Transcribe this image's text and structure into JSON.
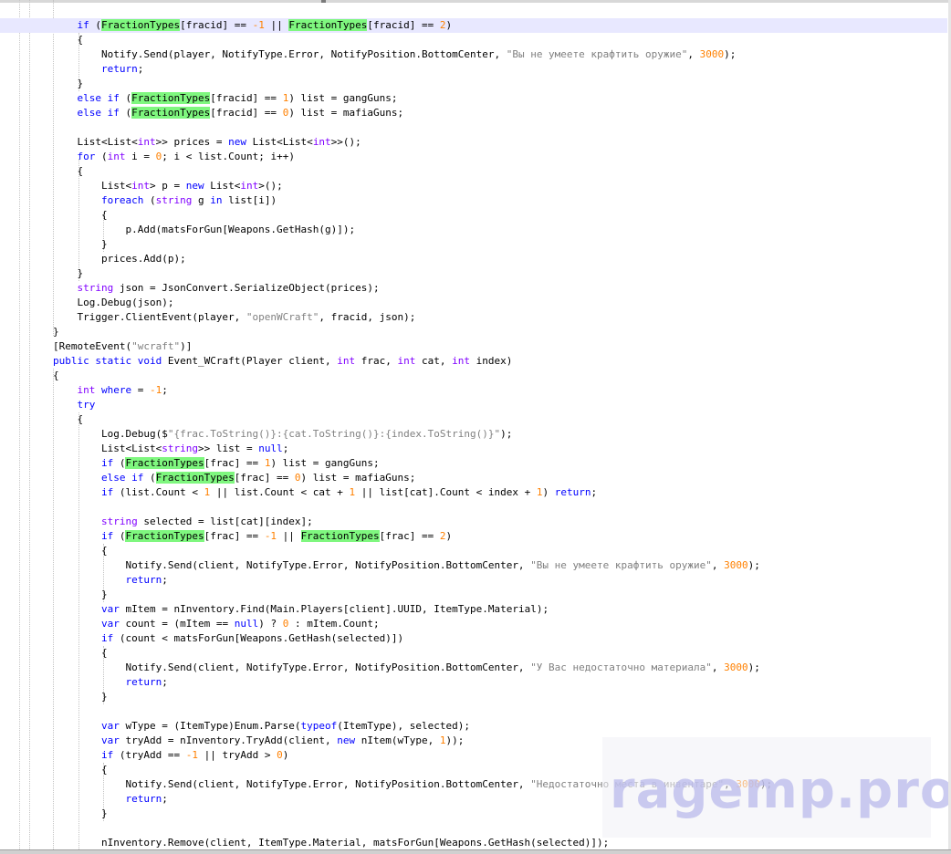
{
  "editor": {
    "theme": {
      "keyword": "#0000ff",
      "type": "#8000ff",
      "number": "#ff8000",
      "string": "#808080",
      "highlight": "#7ff77f",
      "current_line": "#e8e8ff"
    },
    "lines": [
      [
        [
          "    ",
          ""
        ],
        [
          "if",
          "kw"
        ],
        [
          " (",
          ""
        ],
        [
          "FractionTypes",
          "hl"
        ],
        [
          "[fracid] == ",
          ""
        ],
        [
          "-1",
          "nm"
        ],
        [
          " || ",
          ""
        ],
        [
          "FractionTypes",
          "hl"
        ],
        [
          "[fracid] == ",
          ""
        ],
        [
          "2",
          "nm"
        ],
        [
          ")",
          ""
        ]
      ],
      [
        [
          "    {",
          ""
        ]
      ],
      [
        [
          "        Notify.Send(player, NotifyType.Error, NotifyPosition.BottomCenter, ",
          ""
        ],
        [
          "\"Вы не умеете крафтить оружие\"",
          "st"
        ],
        [
          ", ",
          ""
        ],
        [
          "3000",
          "nm"
        ],
        [
          ");",
          ""
        ]
      ],
      [
        [
          "        ",
          ""
        ],
        [
          "return",
          "kw"
        ],
        [
          ";",
          ""
        ]
      ],
      [
        [
          "    }",
          ""
        ]
      ],
      [
        [
          "    ",
          ""
        ],
        [
          "else if",
          "kw"
        ],
        [
          " (",
          ""
        ],
        [
          "FractionTypes",
          "hl"
        ],
        [
          "[fracid] == ",
          ""
        ],
        [
          "1",
          "nm"
        ],
        [
          ") list = gangGuns;",
          ""
        ]
      ],
      [
        [
          "    ",
          ""
        ],
        [
          "else if",
          "kw"
        ],
        [
          " (",
          ""
        ],
        [
          "FractionTypes",
          "hl"
        ],
        [
          "[fracid] == ",
          ""
        ],
        [
          "0",
          "nm"
        ],
        [
          ") list = mafiaGuns;",
          ""
        ]
      ],
      [
        [
          "",
          ""
        ]
      ],
      [
        [
          "    List<List<",
          ""
        ],
        [
          "int",
          "ty"
        ],
        [
          ">> prices = ",
          ""
        ],
        [
          "new",
          "kw"
        ],
        [
          " List<List<",
          ""
        ],
        [
          "int",
          "ty"
        ],
        [
          ">>();",
          ""
        ]
      ],
      [
        [
          "    ",
          ""
        ],
        [
          "for",
          "kw"
        ],
        [
          " (",
          ""
        ],
        [
          "int",
          "ty"
        ],
        [
          " i = ",
          ""
        ],
        [
          "0",
          "nm"
        ],
        [
          "; i < list.Count; i++)",
          ""
        ]
      ],
      [
        [
          "    {",
          ""
        ]
      ],
      [
        [
          "        List<",
          ""
        ],
        [
          "int",
          "ty"
        ],
        [
          "> p = ",
          ""
        ],
        [
          "new",
          "kw"
        ],
        [
          " List<",
          ""
        ],
        [
          "int",
          "ty"
        ],
        [
          ">();",
          ""
        ]
      ],
      [
        [
          "        ",
          ""
        ],
        [
          "foreach",
          "kw"
        ],
        [
          " (",
          ""
        ],
        [
          "string",
          "ty"
        ],
        [
          " g ",
          ""
        ],
        [
          "in",
          "kw"
        ],
        [
          " list[i])",
          ""
        ]
      ],
      [
        [
          "        {",
          ""
        ]
      ],
      [
        [
          "            p.Add(matsForGun[Weapons.GetHash(g)]);",
          ""
        ]
      ],
      [
        [
          "        }",
          ""
        ]
      ],
      [
        [
          "        prices.Add(p);",
          ""
        ]
      ],
      [
        [
          "    }",
          ""
        ]
      ],
      [
        [
          "    ",
          ""
        ],
        [
          "string",
          "ty"
        ],
        [
          " json = JsonConvert.SerializeObject(prices);",
          ""
        ]
      ],
      [
        [
          "    Log.Debug(json);",
          ""
        ]
      ],
      [
        [
          "    Trigger.ClientEvent(player, ",
          ""
        ],
        [
          "\"openWCraft\"",
          "st"
        ],
        [
          ", fracid, json);",
          ""
        ]
      ],
      [
        [
          "}",
          ""
        ]
      ],
      [
        [
          "[RemoteEvent(",
          ""
        ],
        [
          "\"wcraft\"",
          "st"
        ],
        [
          ")]",
          ""
        ]
      ],
      [
        [
          "",
          ""
        ],
        [
          "public static void",
          "kw"
        ],
        [
          " Event_WCraft(Player client, ",
          ""
        ],
        [
          "int",
          "ty"
        ],
        [
          " frac, ",
          ""
        ],
        [
          "int",
          "ty"
        ],
        [
          " cat, ",
          ""
        ],
        [
          "int",
          "ty"
        ],
        [
          " index)",
          ""
        ]
      ],
      [
        [
          "{",
          ""
        ]
      ],
      [
        [
          "    ",
          ""
        ],
        [
          "int",
          "ty"
        ],
        [
          " ",
          ""
        ],
        [
          "where",
          "kw"
        ],
        [
          " = ",
          ""
        ],
        [
          "-1",
          "nm"
        ],
        [
          ";",
          ""
        ]
      ],
      [
        [
          "    ",
          ""
        ],
        [
          "try",
          "kw"
        ]
      ],
      [
        [
          "    {",
          ""
        ]
      ],
      [
        [
          "        Log.Debug($",
          ""
        ],
        [
          "\"{frac.ToString()}:{cat.ToString()}:{index.ToString()}\"",
          "st"
        ],
        [
          ");",
          ""
        ]
      ],
      [
        [
          "        List<List<",
          ""
        ],
        [
          "string",
          "ty"
        ],
        [
          ">> list = ",
          ""
        ],
        [
          "null",
          "kw"
        ],
        [
          ";",
          ""
        ]
      ],
      [
        [
          "        ",
          ""
        ],
        [
          "if",
          "kw"
        ],
        [
          " (",
          ""
        ],
        [
          "FractionTypes",
          "hl"
        ],
        [
          "[frac] == ",
          ""
        ],
        [
          "1",
          "nm"
        ],
        [
          ") list = gangGuns;",
          ""
        ]
      ],
      [
        [
          "        ",
          ""
        ],
        [
          "else if",
          "kw"
        ],
        [
          " (",
          ""
        ],
        [
          "FractionTypes",
          "hl"
        ],
        [
          "[frac] == ",
          ""
        ],
        [
          "0",
          "nm"
        ],
        [
          ") list = mafiaGuns;",
          ""
        ]
      ],
      [
        [
          "        ",
          ""
        ],
        [
          "if",
          "kw"
        ],
        [
          " (list.Count < ",
          ""
        ],
        [
          "1",
          "nm"
        ],
        [
          " || list.Count < cat + ",
          ""
        ],
        [
          "1",
          "nm"
        ],
        [
          " || list[cat].Count < index + ",
          ""
        ],
        [
          "1",
          "nm"
        ],
        [
          ") ",
          ""
        ],
        [
          "return",
          "kw"
        ],
        [
          ";",
          ""
        ]
      ],
      [
        [
          "",
          ""
        ]
      ],
      [
        [
          "        ",
          ""
        ],
        [
          "string",
          "ty"
        ],
        [
          " selected = list[cat][index];",
          ""
        ]
      ],
      [
        [
          "        ",
          ""
        ],
        [
          "if",
          "kw"
        ],
        [
          " (",
          ""
        ],
        [
          "FractionTypes",
          "hl"
        ],
        [
          "[frac] == ",
          ""
        ],
        [
          "-1",
          "nm"
        ],
        [
          " || ",
          ""
        ],
        [
          "FractionTypes",
          "hl"
        ],
        [
          "[frac] == ",
          ""
        ],
        [
          "2",
          "nm"
        ],
        [
          ")",
          ""
        ]
      ],
      [
        [
          "        {",
          ""
        ]
      ],
      [
        [
          "            Notify.Send(client, NotifyType.Error, NotifyPosition.BottomCenter, ",
          ""
        ],
        [
          "\"Вы не умеете крафтить оружие\"",
          "st"
        ],
        [
          ", ",
          ""
        ],
        [
          "3000",
          "nm"
        ],
        [
          ");",
          ""
        ]
      ],
      [
        [
          "            ",
          ""
        ],
        [
          "return",
          "kw"
        ],
        [
          ";",
          ""
        ]
      ],
      [
        [
          "        }",
          ""
        ]
      ],
      [
        [
          "        ",
          ""
        ],
        [
          "var",
          "kw"
        ],
        [
          " mItem = nInventory.Find(Main.Players[client].UUID, ItemType.Material);",
          ""
        ]
      ],
      [
        [
          "        ",
          ""
        ],
        [
          "var",
          "kw"
        ],
        [
          " count = (mItem == ",
          ""
        ],
        [
          "null",
          "kw"
        ],
        [
          ") ? ",
          ""
        ],
        [
          "0",
          "nm"
        ],
        [
          " : mItem.Count;",
          ""
        ]
      ],
      [
        [
          "        ",
          ""
        ],
        [
          "if",
          "kw"
        ],
        [
          " (count < matsForGun[Weapons.GetHash(selected)])",
          ""
        ]
      ],
      [
        [
          "        {",
          ""
        ]
      ],
      [
        [
          "            Notify.Send(client, NotifyType.Error, NotifyPosition.BottomCenter, ",
          ""
        ],
        [
          "\"У Вас недостаточно материала\"",
          "st"
        ],
        [
          ", ",
          ""
        ],
        [
          "3000",
          "nm"
        ],
        [
          ");",
          ""
        ]
      ],
      [
        [
          "            ",
          ""
        ],
        [
          "return",
          "kw"
        ],
        [
          ";",
          ""
        ]
      ],
      [
        [
          "        }",
          ""
        ]
      ],
      [
        [
          "",
          ""
        ]
      ],
      [
        [
          "        ",
          ""
        ],
        [
          "var",
          "kw"
        ],
        [
          " wType = (ItemType)Enum.Parse(",
          ""
        ],
        [
          "typeof",
          "kw"
        ],
        [
          "(ItemType), selected);",
          ""
        ]
      ],
      [
        [
          "        ",
          ""
        ],
        [
          "var",
          "kw"
        ],
        [
          " tryAdd = nInventory.TryAdd(client, ",
          ""
        ],
        [
          "new",
          "kw"
        ],
        [
          " nItem(wType, ",
          ""
        ],
        [
          "1",
          "nm"
        ],
        [
          "));",
          ""
        ]
      ],
      [
        [
          "        ",
          ""
        ],
        [
          "if",
          "kw"
        ],
        [
          " (tryAdd == ",
          ""
        ],
        [
          "-1",
          "nm"
        ],
        [
          " || tryAdd > ",
          ""
        ],
        [
          "0",
          "nm"
        ],
        [
          ")",
          ""
        ]
      ],
      [
        [
          "        {",
          ""
        ]
      ],
      [
        [
          "            Notify.Send(client, NotifyType.Error, NotifyPosition.BottomCenter, ",
          ""
        ],
        [
          "\"Недостаточно места в инвентаре\"",
          "st"
        ],
        [
          ", ",
          ""
        ],
        [
          "3000",
          "nm"
        ],
        [
          ");",
          ""
        ]
      ],
      [
        [
          "            ",
          ""
        ],
        [
          "return",
          "kw"
        ],
        [
          ";",
          ""
        ]
      ],
      [
        [
          "        }",
          ""
        ]
      ],
      [
        [
          "",
          ""
        ]
      ],
      [
        [
          "        nInventory.Remove(client, ItemType.Material, matsForGun[Weapons.GetHash(selected)]);",
          ""
        ]
      ]
    ]
  },
  "watermark": {
    "text": "ragemp.pro"
  }
}
